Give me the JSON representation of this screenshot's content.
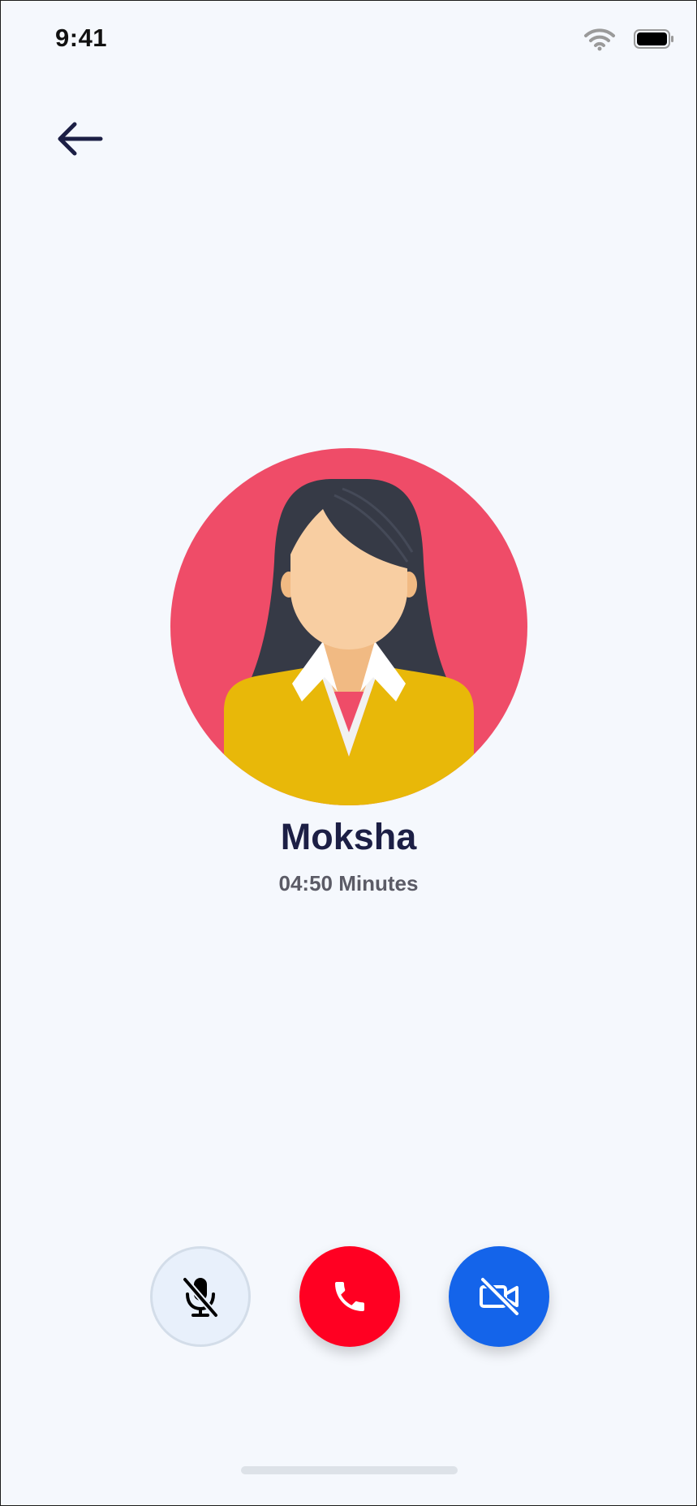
{
  "status_bar": {
    "time": "9:41",
    "icons": [
      "wifi-icon",
      "battery-icon"
    ]
  },
  "navigation": {
    "back_icon": "arrow-left-icon"
  },
  "caller": {
    "name": "Moksha",
    "duration": "04:50 Minutes",
    "avatar_icon": "woman-avatar-icon",
    "avatar_background": "#ef4c68"
  },
  "controls": {
    "mute": {
      "icon": "microphone-off-icon",
      "color": "#e8f0fb"
    },
    "end_call": {
      "icon": "phone-icon",
      "color": "#ff0022"
    },
    "video": {
      "icon": "video-off-icon",
      "color": "#1464ea"
    }
  },
  "colors": {
    "background": "#f5f8fd",
    "name_text": "#1c1f45",
    "duration_text": "#5b5b66"
  }
}
